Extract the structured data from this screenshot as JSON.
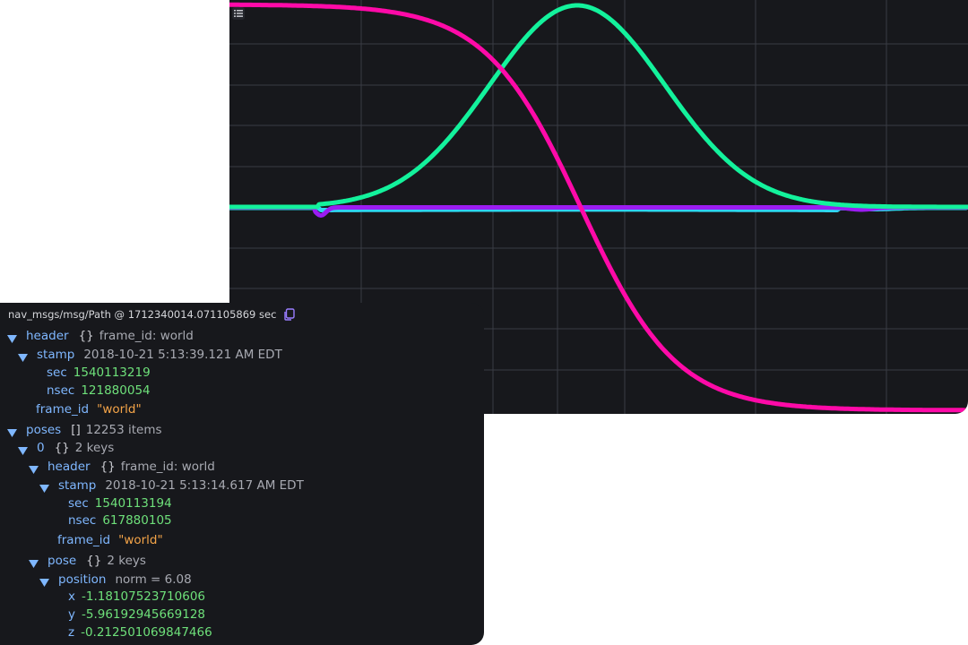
{
  "plot": {
    "background": "#17181c",
    "grid_color": "#3a3c44",
    "series": [
      {
        "color": "#ff0aa8",
        "shape": "falling-sigmoid"
      },
      {
        "color": "#13f29c",
        "shape": "bell"
      },
      {
        "color": "#2ed5f0",
        "shape": "flat-cyan"
      },
      {
        "color": "#9b1cf2",
        "shape": "flat-purple"
      }
    ],
    "legend_icon": "list-icon"
  },
  "raw": {
    "title": "nav_msgs/msg/Path @ 1712340014.071105869 sec",
    "copy_icon": "copy-icon",
    "header_key": "header",
    "header_brace": "{}",
    "header_meta": "frame_id: world",
    "stamp_key": "stamp",
    "stamp_meta": "2018-10-21 5:13:39.121 AM EDT",
    "sec_key": "sec",
    "sec_val": "1540113219",
    "nsec_key": "nsec",
    "nsec_val": "121880054",
    "frame_key": "frame_id",
    "frame_val": "\"world\"",
    "poses_key": "poses",
    "poses_brace": "[]",
    "poses_meta": "12253 items",
    "pose0_key": "0",
    "pose0_brace": "{}",
    "pose0_meta": "2 keys",
    "p_header_key": "header",
    "p_header_brace": "{}",
    "p_header_meta": "frame_id: world",
    "p_stamp_key": "stamp",
    "p_stamp_meta": "2018-10-21 5:13:14.617 AM EDT",
    "p_sec_key": "sec",
    "p_sec_val": "1540113194",
    "p_nsec_key": "nsec",
    "p_nsec_val": "617880105",
    "p_frame_key": "frame_id",
    "p_frame_val": "\"world\"",
    "pose_key": "pose",
    "pose_brace": "{}",
    "pose_meta": "2 keys",
    "position_key": "position",
    "position_meta": "norm = 6.08",
    "x_key": "x",
    "x_val": "-1.18107523710606",
    "y_key": "y",
    "y_val": "-5.96192945669128",
    "z_key": "z",
    "z_val": "-0.212501069847466"
  }
}
